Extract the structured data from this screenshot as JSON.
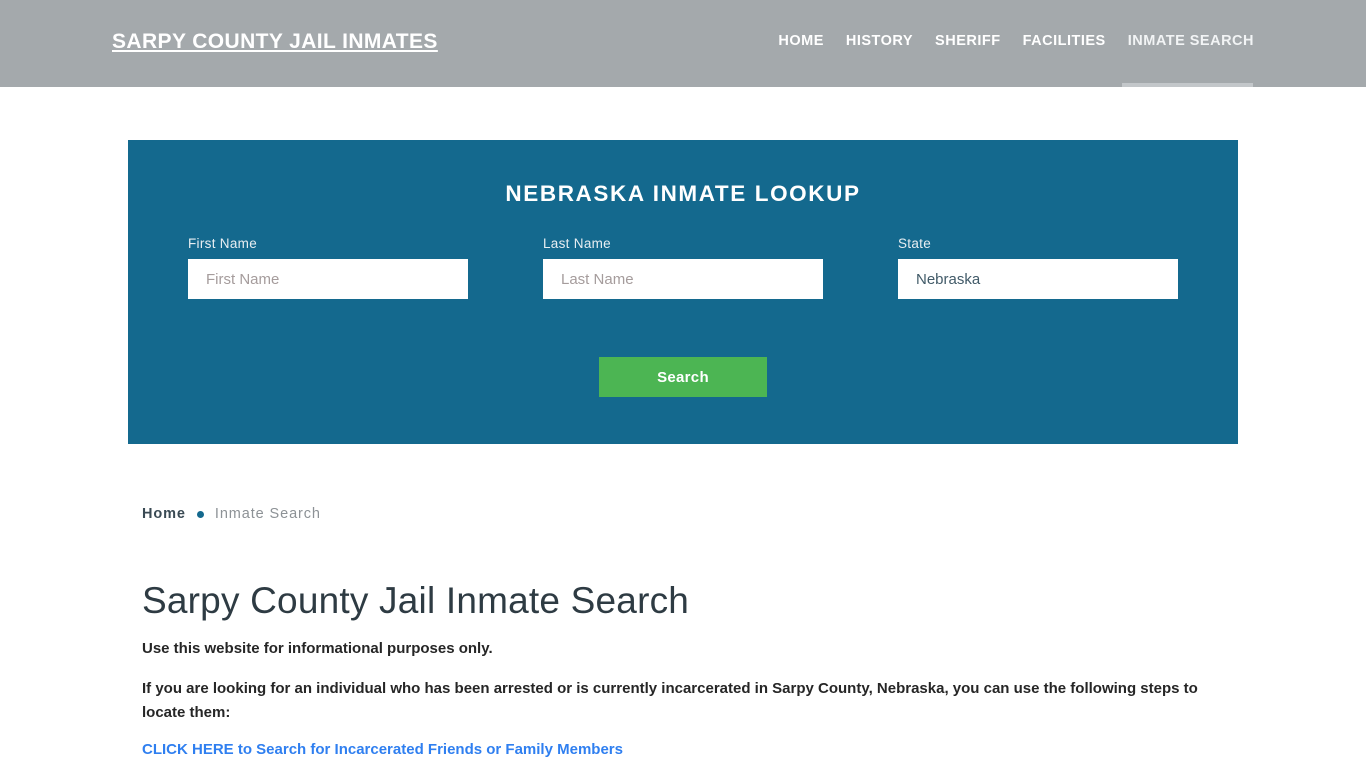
{
  "header": {
    "brand": "SARPY COUNTY JAIL INMATES",
    "nav": [
      {
        "label": "HOME",
        "active": false
      },
      {
        "label": "HISTORY",
        "active": false
      },
      {
        "label": "SHERIFF",
        "active": false
      },
      {
        "label": "FACILITIES",
        "active": false
      },
      {
        "label": "INMATE SEARCH",
        "active": true
      }
    ],
    "background_color": "#a4a9ac",
    "text_color": "#ffffff"
  },
  "lookup": {
    "title": "NEBRASKA INMATE LOOKUP",
    "panel_color": "#14698e",
    "fields": {
      "first_name": {
        "label": "First Name",
        "placeholder": "First Name",
        "value": ""
      },
      "last_name": {
        "label": "Last Name",
        "placeholder": "Last Name",
        "value": ""
      },
      "state": {
        "label": "State",
        "value": "Nebraska",
        "options": [
          "Nebraska"
        ]
      }
    },
    "search_button": {
      "label": "Search",
      "color": "#4cb553"
    }
  },
  "breadcrumb": {
    "home": "Home",
    "separator": "•",
    "current": "Inmate Search"
  },
  "main": {
    "title": "Sarpy County Jail Inmate Search",
    "paragraph_1": "Use this website for informational purposes only.",
    "paragraph_2": "If you are looking for an individual who has been arrested or is currently incarcerated in Sarpy County, Nebraska, you can use the following steps to locate them:",
    "cta_link": "CLICK HERE to Search for Incarcerated Friends or Family Members",
    "link_color": "#2f7ff0"
  }
}
